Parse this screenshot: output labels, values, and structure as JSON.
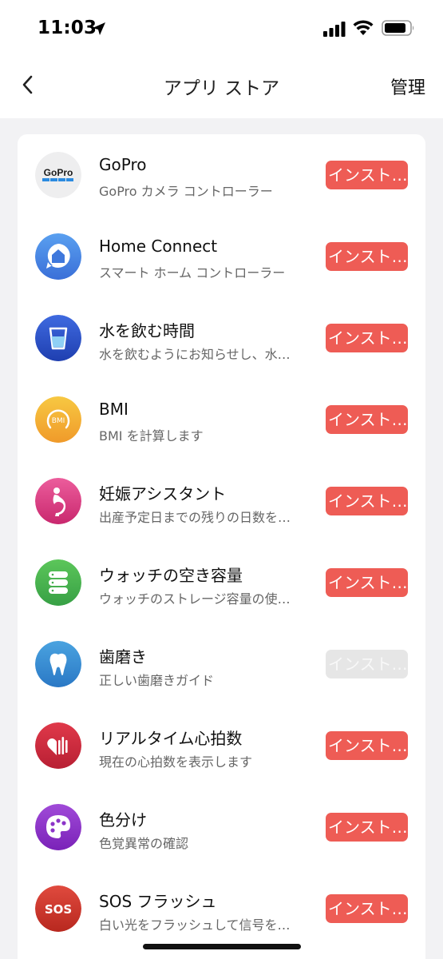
{
  "status_bar": {
    "time": "11:03"
  },
  "nav": {
    "title": "アプリ ストア",
    "manage": "管理"
  },
  "apps": [
    {
      "name": "GoPro",
      "desc": "GoPro カメラ コントローラー",
      "button": "インスト…",
      "enabled": true
    },
    {
      "name": "Home Connect",
      "desc": "スマート ホーム コントローラー",
      "button": "インスト…",
      "enabled": true
    },
    {
      "name": "水を飲む時間",
      "desc": "水を飲むようにお知らせし、水…",
      "button": "インスト…",
      "enabled": true
    },
    {
      "name": "BMI",
      "desc": "BMI を計算します",
      "button": "インスト…",
      "enabled": true
    },
    {
      "name": "妊娠アシスタント",
      "desc": "出産予定日までの残りの日数を…",
      "button": "インスト…",
      "enabled": true
    },
    {
      "name": "ウォッチの空き容量",
      "desc": "ウォッチのストレージ容量の使…",
      "button": "インスト…",
      "enabled": true
    },
    {
      "name": "歯磨き",
      "desc": "正しい歯磨きガイド",
      "button": "インスト…",
      "enabled": false
    },
    {
      "name": "リアルタイム心拍数",
      "desc": "現在の心拍数を表示します",
      "button": "インスト…",
      "enabled": true
    },
    {
      "name": "色分け",
      "desc": "色覚異常の確認",
      "button": "インスト…",
      "enabled": true
    },
    {
      "name": "SOS フラッシュ",
      "desc": "白い光をフラッシュして信号を…",
      "button": "インスト…",
      "enabled": true
    }
  ],
  "icons": {
    "gopro_logo_text": "GoPro",
    "bmi_text": "BMI",
    "sos_text": "SOS"
  },
  "colors": {
    "install_active": "#ee5c55",
    "install_disabled": "#e6e6e6"
  }
}
